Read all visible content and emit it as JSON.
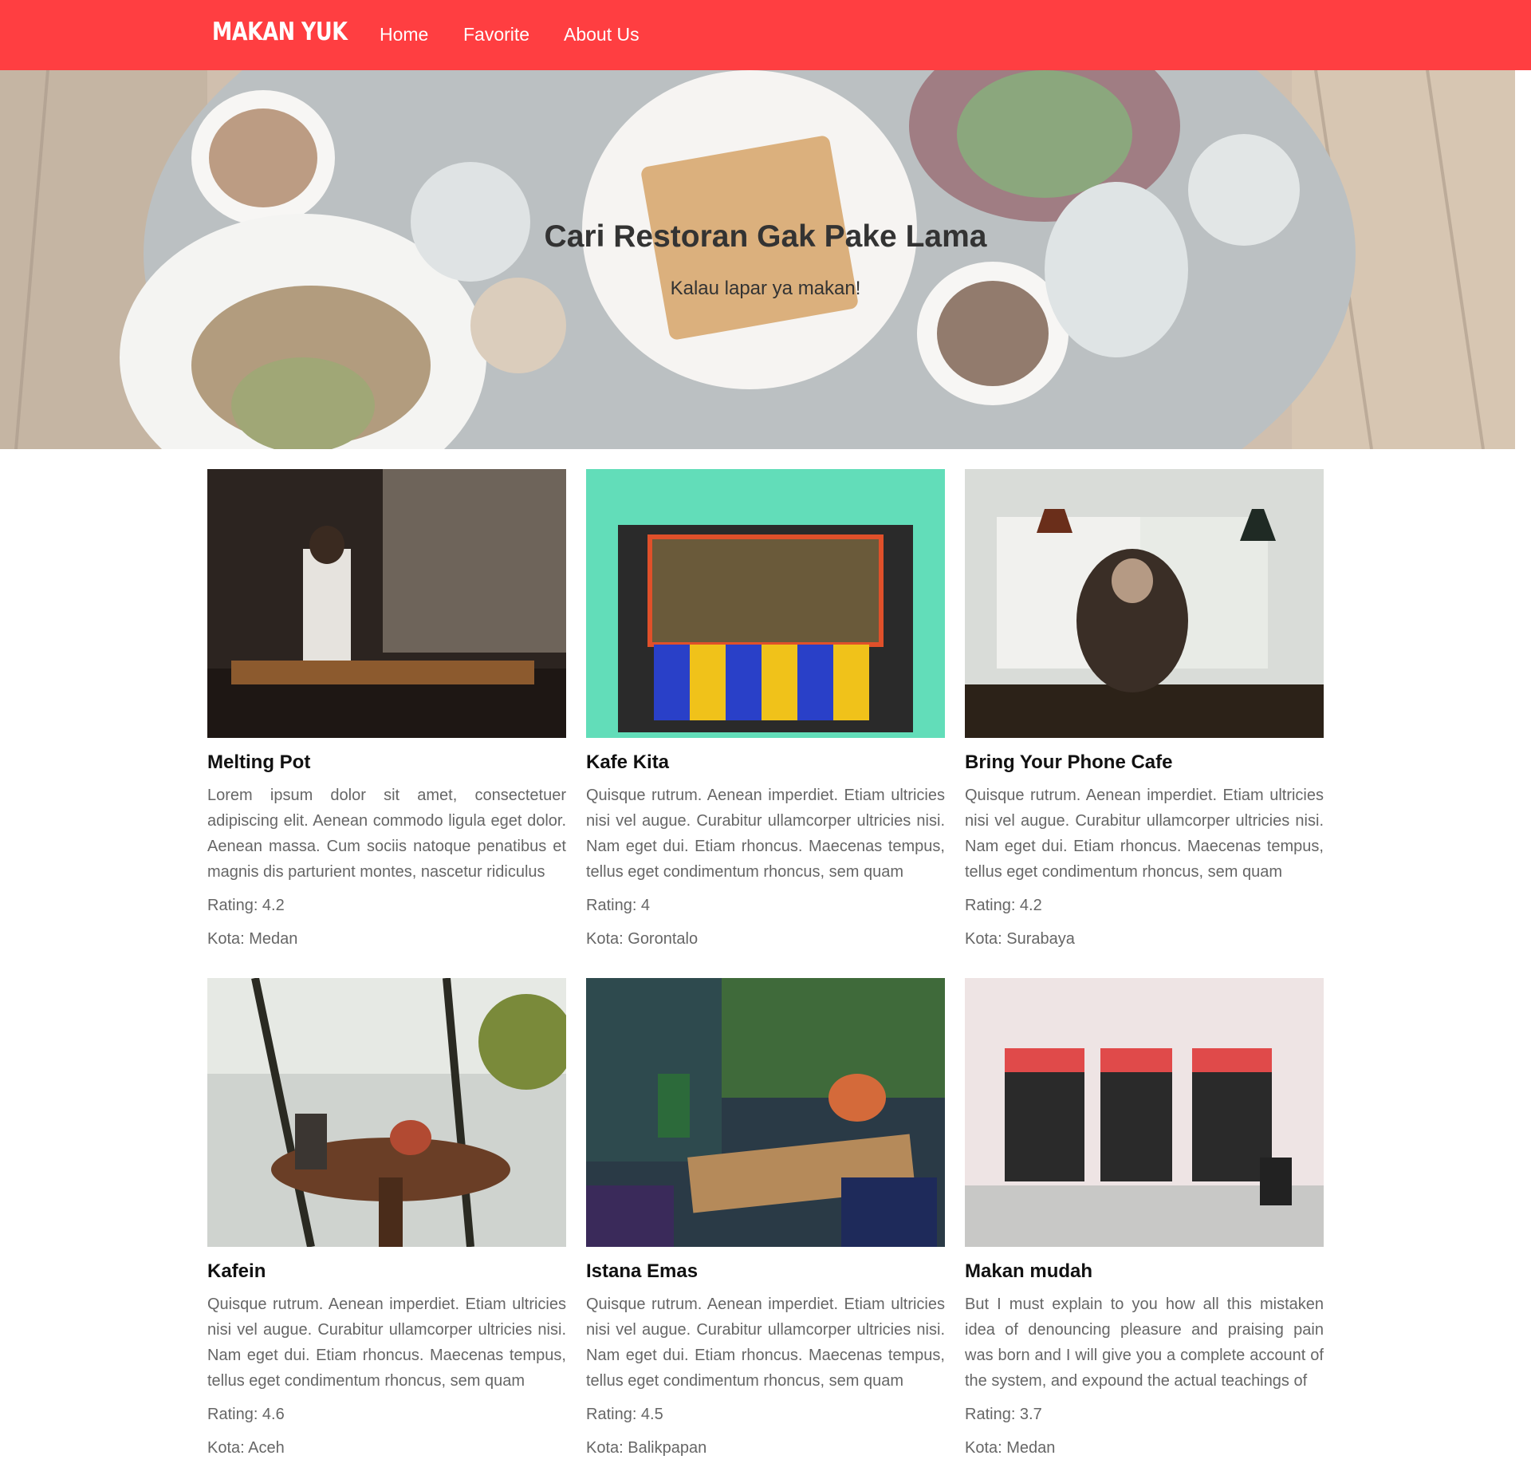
{
  "navbar": {
    "brand": "MAKAN YUK",
    "links": [
      "Home",
      "Favorite",
      "About Us"
    ],
    "color": "#ff3e41"
  },
  "hero": {
    "title": "Cari Restoran Gak Pake Lama",
    "subtitle": "Kalau lapar ya makan!"
  },
  "restaurants": [
    {
      "name": "Melting Pot",
      "description": "Lorem ipsum dolor sit amet, consectetuer adipiscing elit. Aenean commodo ligula eget dolor. Aenean massa. Cum sociis natoque penatibus et magnis dis parturient montes, nascetur ridiculus",
      "rating": "Rating: 4.2",
      "city": "Kota: Medan"
    },
    {
      "name": "Kafe Kita",
      "description": "Quisque rutrum. Aenean imperdiet. Etiam ultricies nisi vel augue. Curabitur ullamcorper ultricies nisi. Nam eget dui. Etiam rhoncus. Maecenas tempus, tellus eget condimentum rhoncus, sem quam",
      "rating": "Rating: 4",
      "city": "Kota: Gorontalo"
    },
    {
      "name": "Bring Your Phone Cafe",
      "description": "Quisque rutrum. Aenean imperdiet. Etiam ultricies nisi vel augue. Curabitur ullamcorper ultricies nisi. Nam eget dui. Etiam rhoncus. Maecenas tempus, tellus eget condimentum rhoncus, sem quam",
      "rating": "Rating: 4.2",
      "city": "Kota: Surabaya"
    },
    {
      "name": "Kafein",
      "description": "Quisque rutrum. Aenean imperdiet. Etiam ultricies nisi vel augue. Curabitur ullamcorper ultricies nisi. Nam eget dui. Etiam rhoncus. Maecenas tempus, tellus eget condimentum rhoncus, sem quam",
      "rating": "Rating: 4.6",
      "city": "Kota: Aceh"
    },
    {
      "name": "Istana Emas",
      "description": "Quisque rutrum. Aenean imperdiet. Etiam ultricies nisi vel augue. Curabitur ullamcorper ultricies nisi. Nam eget dui. Etiam rhoncus. Maecenas tempus, tellus eget condimentum rhoncus, sem quam",
      "rating": "Rating: 4.5",
      "city": "Kota: Balikpapan"
    },
    {
      "name": "Makan mudah",
      "description": "But I must explain to you how all this mistaken idea of denouncing pleasure and praising pain was born and I will give you a complete account of the system, and expound the actual teachings of",
      "rating": "Rating: 3.7",
      "city": "Kota: Medan"
    }
  ]
}
